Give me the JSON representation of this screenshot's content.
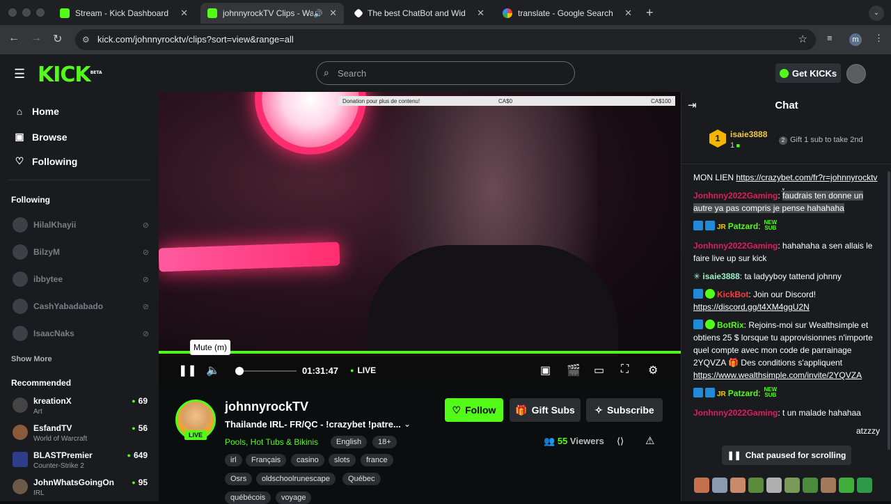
{
  "browser": {
    "tabs": [
      {
        "title": "Stream - Kick Dashboard",
        "favicon_color": "#53fc18"
      },
      {
        "title": "johnnyrockTV Clips - Watc",
        "favicon_color": "#53fc18"
      },
      {
        "title": "The best ChatBot and Widget",
        "favicon_color": "#ffffff"
      },
      {
        "title": "translate - Google Search",
        "favicon_color": "#4285f4"
      }
    ],
    "url": "kick.com/johnnyrocktv/clips?sort=view&range=all",
    "profile_initial": "m"
  },
  "header": {
    "logo": "KICK",
    "logo_tag": "BETA",
    "search_placeholder": "Search",
    "get_kicks_label": "Get KICKs"
  },
  "sidebar": {
    "nav": [
      {
        "label": "Home",
        "icon": "home-icon"
      },
      {
        "label": "Browse",
        "icon": "browse-icon"
      },
      {
        "label": "Following",
        "icon": "heart-icon"
      }
    ],
    "following_title": "Following",
    "following": [
      {
        "name": "HilalKhayii"
      },
      {
        "name": "BilzyM"
      },
      {
        "name": "ibbytee"
      },
      {
        "name": "CashYabadabado"
      },
      {
        "name": "IsaacNaks"
      }
    ],
    "show_more": "Show More",
    "recommended_title": "Recommended",
    "recommended": [
      {
        "name": "kreationX",
        "category": "Art",
        "viewers": "69"
      },
      {
        "name": "EsfandTV",
        "category": "World of Warcraft",
        "viewers": "56"
      },
      {
        "name": "BLASTPremier",
        "category": "Counter-Strike 2",
        "viewers": "649"
      },
      {
        "name": "JohnWhatsGoingOn",
        "category": "IRL",
        "viewers": "95"
      }
    ]
  },
  "player": {
    "donation_label": "Donation pour plus de contenu!",
    "donation_current": "CA$0",
    "donation_goal": "CA$100",
    "time": "01:31:47",
    "live_label": "LIVE",
    "tooltip": "Mute (m)"
  },
  "stream": {
    "streamer": "johnnyrockTV",
    "live_badge": "LIVE",
    "title": "Thailande IRL- FR/QC - !crazybet !patre...",
    "category": "Pools, Hot Tubs & Bikinis",
    "tags_row1": [
      "English",
      "18+"
    ],
    "tags_row2": [
      "irl",
      "Français",
      "casino",
      "slots",
      "france"
    ],
    "tags_row3": [
      "Osrs",
      "oldschoolrunescape",
      "Québec"
    ],
    "tags_row4": [
      "québécois",
      "voyage"
    ],
    "follow_label": "Follow",
    "gift_label": "Gift Subs",
    "subscribe_label": "Subscribe",
    "viewers_count": "55",
    "viewers_label": "Viewers"
  },
  "chat": {
    "title": "Chat",
    "pinned_rank": "1",
    "pinned_user": "isaie3888",
    "pinned_count": "1",
    "pinned_gift": "Gift 1 sub to take 2nd",
    "paused_label": "Chat paused for scrolling",
    "messages": [
      {
        "user": "",
        "text": "MON LIEN ",
        "link": "https://crazybet.com/fr?r=johnnyrocktv"
      },
      {
        "user": "Jonhnny2022Gaming",
        "text": "faudrais ten donne un autre ya pas compris je pense hahahaha"
      },
      {
        "user": "Patzard",
        "text": ""
      },
      {
        "user": "Jonhnny2022Gaming",
        "text": "hahahaha a sen allais le faire live up sur kick"
      },
      {
        "user": "isaie3888",
        "text": "ta ladyyboy tattend johnny"
      },
      {
        "user": "KickBot",
        "text": "Join our Discord!",
        "link": "https://discord.gg/t4XM4ggU2N"
      },
      {
        "user": "BotRix",
        "text": "Rejoins-moi sur Wealthsimple et obtiens 25 $ lorsque tu approvisionnes n'importe quel compte avec mon code de parrainage 2YQVZA 🎁 Des conditions s'appliquent",
        "link": "https://www.wealthsimple.com/invite/2YQVZA"
      },
      {
        "user": "Patzard",
        "text": ""
      },
      {
        "user": "Jonhnny2022Gaming",
        "text": "t un malade hahahaa"
      },
      {
        "user": "",
        "text": "atzzzy"
      }
    ],
    "newsub": "NEW SUB"
  }
}
